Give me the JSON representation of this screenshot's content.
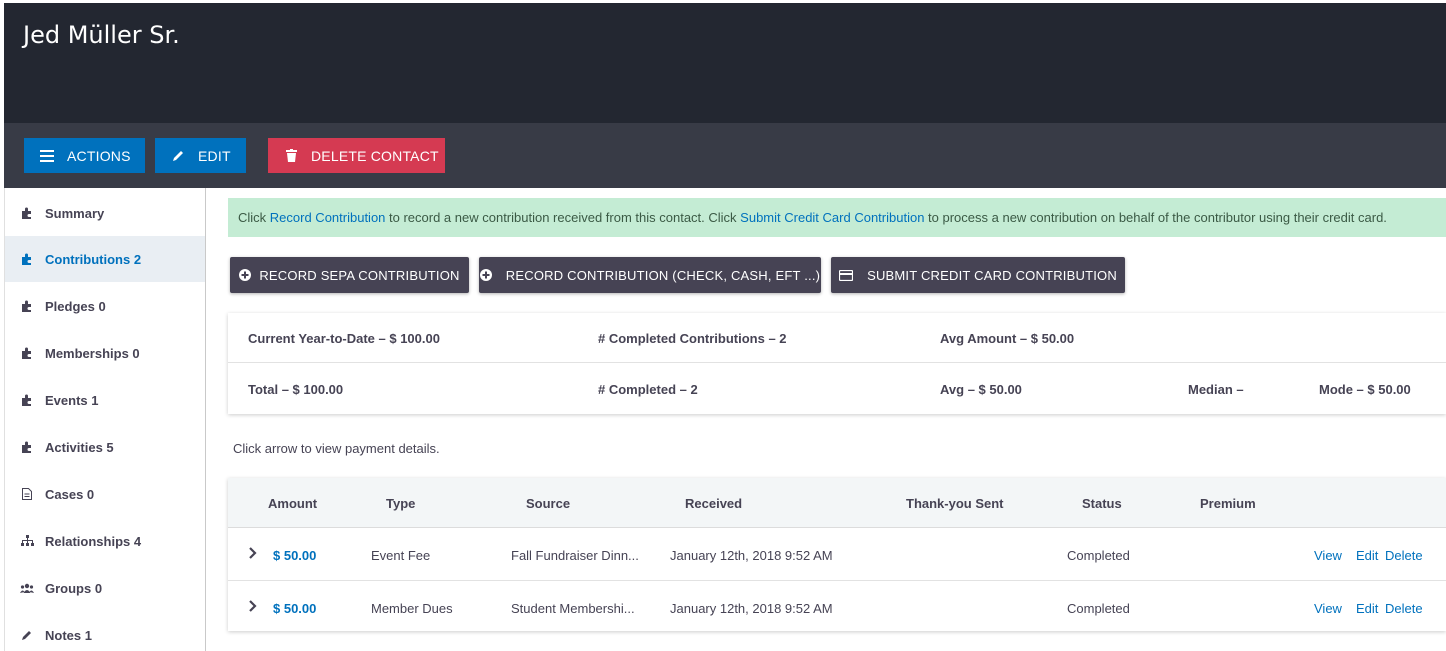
{
  "header": {
    "title": "Jed Müller Sr."
  },
  "actions": {
    "actions_label": "ACTIONS",
    "edit_label": "EDIT",
    "delete_label": "DELETE CONTACT"
  },
  "sidebar": {
    "items": [
      {
        "label": "Summary",
        "icon": "puzzle-icon"
      },
      {
        "label": "Contributions 2",
        "icon": "puzzle-icon",
        "active": true
      },
      {
        "label": "Pledges 0",
        "icon": "puzzle-icon"
      },
      {
        "label": "Memberships 0",
        "icon": "puzzle-icon"
      },
      {
        "label": "Events 1",
        "icon": "puzzle-icon"
      },
      {
        "label": "Activities 5",
        "icon": "puzzle-icon"
      },
      {
        "label": "Cases 0",
        "icon": "file-icon"
      },
      {
        "label": "Relationships 4",
        "icon": "sitemap-icon"
      },
      {
        "label": "Groups 0",
        "icon": "users-icon"
      },
      {
        "label": "Notes 1",
        "icon": "pencil-icon"
      }
    ]
  },
  "notice": {
    "part1": "Click ",
    "link1": "Record Contribution",
    "part2": " to record a new contribution received from this contact. Click ",
    "link2": "Submit Credit Card Contribution",
    "part3": " to process a new contribution on behalf of the contributor using their credit card."
  },
  "buttons": {
    "sepa": "RECORD SEPA CONTRIBUTION",
    "record": "RECORD CONTRIBUTION (CHECK, CASH, EFT ...)",
    "credit": "SUBMIT CREDIT CARD CONTRIBUTION"
  },
  "summary": {
    "ytd": "Current Year-to-Date – $ 100.00",
    "completed_contributions": "# Completed Contributions – 2",
    "avg_amount": "Avg Amount – $ 50.00",
    "total": "Total – $ 100.00",
    "completed": "# Completed – 2",
    "avg": "Avg – $ 50.00",
    "median": "Median –",
    "mode": "Mode – $ 50.00"
  },
  "hint": "Click arrow to view payment details.",
  "table": {
    "headers": {
      "amount": "Amount",
      "type": "Type",
      "source": "Source",
      "received": "Received",
      "thankyou": "Thank-you Sent",
      "status": "Status",
      "premium": "Premium"
    },
    "rows": [
      {
        "amount": "$ 50.00",
        "type": "Event Fee",
        "source": "Fall Fundraiser Dinn...",
        "received": "January 12th, 2018 9:52 AM",
        "status": "Completed",
        "view": "View",
        "edit": "Edit",
        "delete": "Delete"
      },
      {
        "amount": "$ 50.00",
        "type": "Member Dues",
        "source": "Student Membershi...",
        "received": "January 12th, 2018 9:52 AM",
        "status": "Completed",
        "view": "View",
        "edit": "Edit",
        "delete": "Delete"
      }
    ]
  },
  "colors": {
    "primary": "#0071bd",
    "danger": "#d53a52",
    "header_bg": "#232731",
    "actionbar_bg": "#383b46",
    "button_dark": "#464354",
    "notice_bg": "#c4ecd4"
  }
}
